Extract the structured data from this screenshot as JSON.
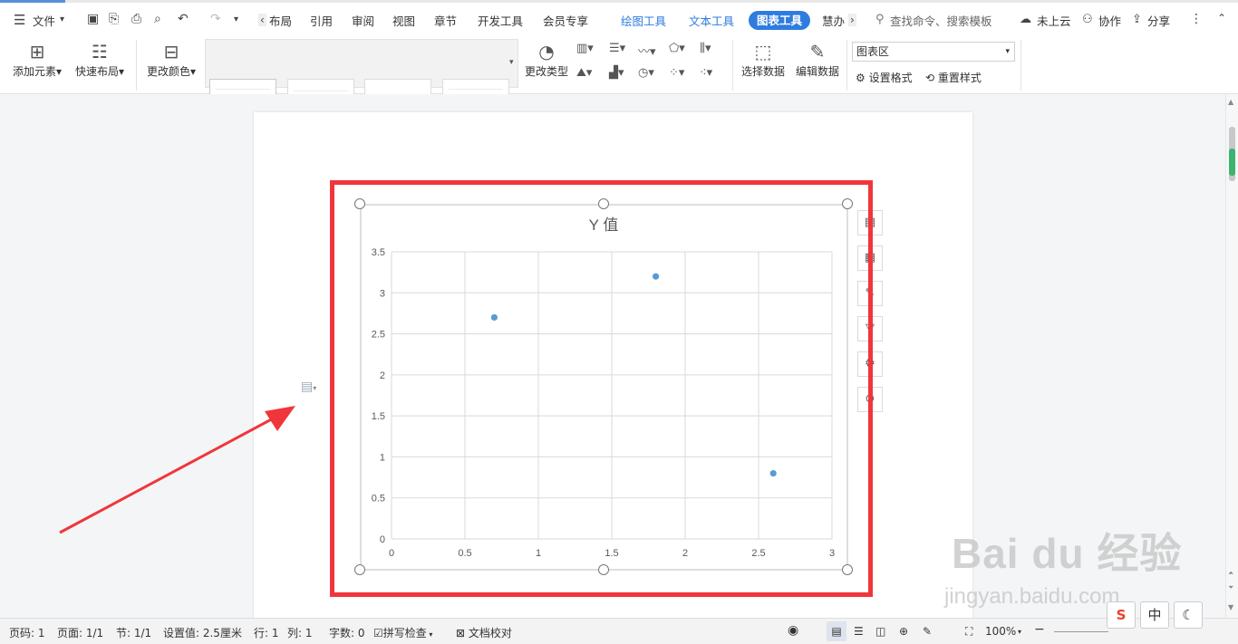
{
  "menu": {
    "file": "文件",
    "tabs": [
      "布局",
      "引用",
      "审阅",
      "视图",
      "章节",
      "开发工具",
      "会员专享"
    ],
    "tool_tabs": [
      "绘图工具",
      "文本工具"
    ],
    "active_tab": "图表工具",
    "overflow_tab": "慧办",
    "search_placeholder": "查找命令、搜索模板",
    "cloud": "未上云",
    "collaborate": "协作",
    "share": "分享"
  },
  "ribbon": {
    "add_element": "添加元素",
    "quick_layout": "快速布局",
    "change_color": "更改颜色",
    "change_type": "更改类型",
    "select_data": "选择数据",
    "edit_data": "编辑数据",
    "area_select": "图表区",
    "set_format": "设置格式",
    "reset_style": "重置样式"
  },
  "chart_data": {
    "type": "scatter",
    "title": "Y 值",
    "x": [
      0.7,
      1.8,
      2.6
    ],
    "y": [
      2.7,
      3.2,
      0.8
    ],
    "xlim": [
      0,
      3
    ],
    "ylim": [
      0,
      3.5
    ],
    "x_ticks": [
      "0",
      "0.5",
      "1",
      "1.5",
      "2",
      "2.5",
      "3"
    ],
    "y_ticks": [
      "0",
      "0.5",
      "1",
      "1.5",
      "2",
      "2.5",
      "3",
      "3.5"
    ],
    "grid": true,
    "point_color": "#5b9bd5"
  },
  "status": {
    "page_num": "页码: 1",
    "pages": "页面: 1/1",
    "section": "节: 1/1",
    "setting": "设置值: 2.5厘米",
    "row": "行: 1",
    "col": "列: 1",
    "words": "字数: 0",
    "spell": "拼写检查",
    "proof": "文档校对",
    "zoom": "100%"
  },
  "ime": {
    "mode": "中"
  },
  "watermark": {
    "brand": "Bai du 经验",
    "url": "jingyan.baidu.com"
  },
  "colors": {
    "accent": "#2f7ce0",
    "highlight_box": "#f0363b"
  }
}
